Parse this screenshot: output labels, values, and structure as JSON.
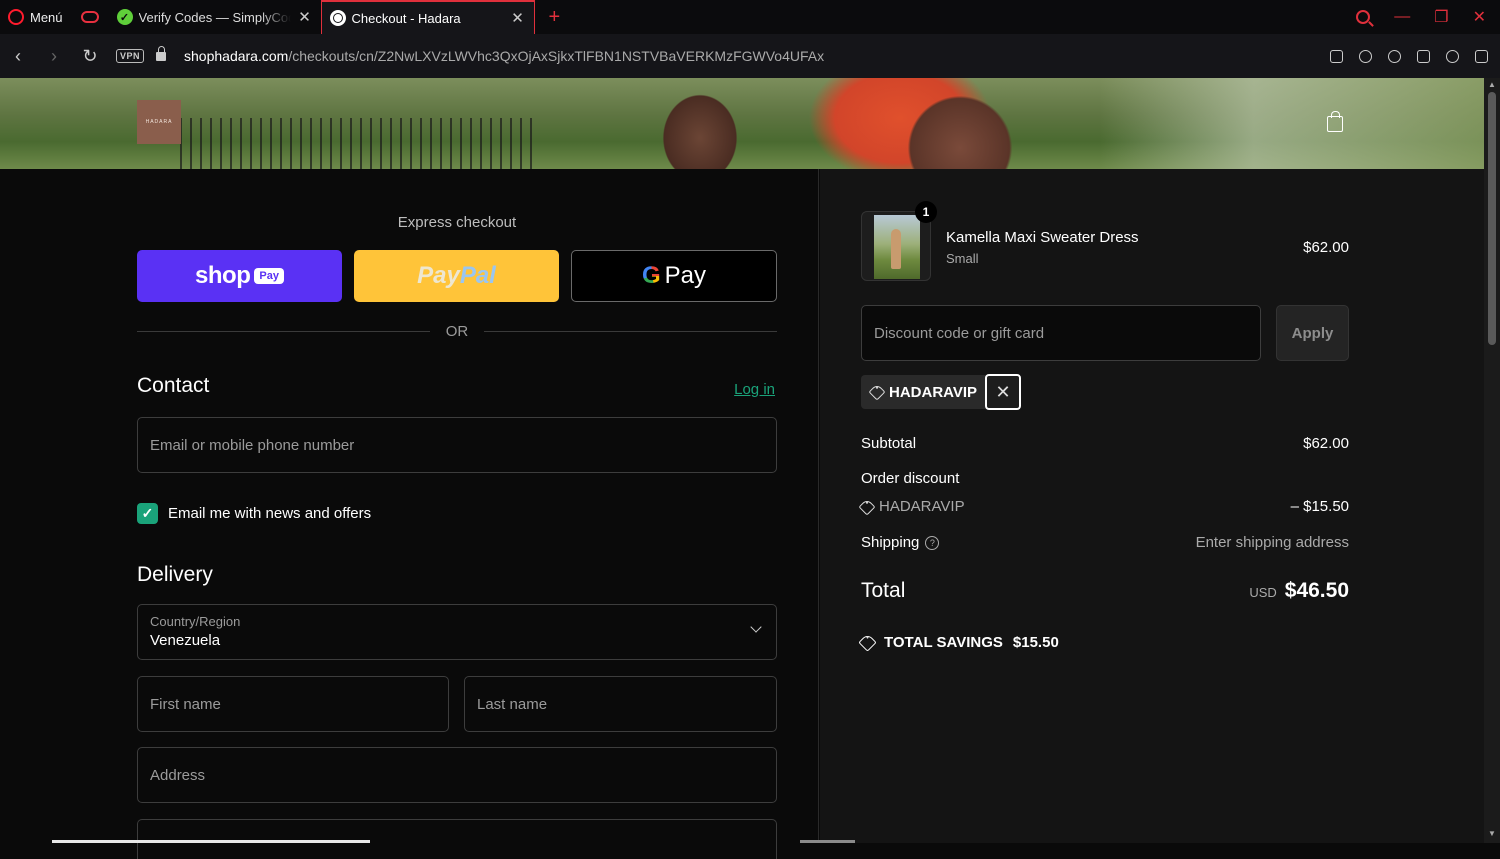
{
  "browser": {
    "menu_label": "Menú",
    "tabs": [
      {
        "title": "Verify Codes — SimplyCodes"
      },
      {
        "title": "Checkout - Hadara"
      }
    ],
    "vpn_label": "VPN",
    "url_host": "shophadara.com",
    "url_path": "/checkouts/cn/Z2NwLXVzLWVhc3QxOjAxSjkxTlFBN1NSTVBaVERKMzFGWVo4UFAx",
    "accent_color": "#e0303c"
  },
  "header": {
    "logo_text": "HADARA"
  },
  "express": {
    "title": "Express checkout",
    "shop_pay_word": "shop",
    "shop_pay_pill": "Pay",
    "paypal_part1": "Pay",
    "paypal_part2": "Pal",
    "gpay_g": "G",
    "gpay_text": "Pay",
    "or_label": "OR"
  },
  "contact": {
    "heading": "Contact",
    "login_link": "Log in",
    "email_placeholder": "Email or mobile phone number",
    "newsletter_label": "Email me with news and offers",
    "newsletter_checked": true
  },
  "delivery": {
    "heading": "Delivery",
    "country_label": "Country/Region",
    "country_value": "Venezuela",
    "first_name_placeholder": "First name",
    "last_name_placeholder": "Last name",
    "address_placeholder": "Address"
  },
  "summary": {
    "product": {
      "quantity": "1",
      "name": "Kamella Maxi Sweater Dress",
      "variant": "Small",
      "price": "$62.00"
    },
    "discount_placeholder": "Discount code or gift card",
    "apply_label": "Apply",
    "applied_code": "HADARAVIP",
    "subtotal_label": "Subtotal",
    "subtotal_value": "$62.00",
    "order_discount_label": "Order discount",
    "discount_code": "HADARAVIP",
    "discount_value": "– $15.50",
    "shipping_label": "Shipping",
    "shipping_value": "Enter shipping address",
    "total_label": "Total",
    "total_currency": "USD",
    "total_value": "$46.50",
    "savings_label": "TOTAL SAVINGS",
    "savings_value": "$15.50"
  }
}
